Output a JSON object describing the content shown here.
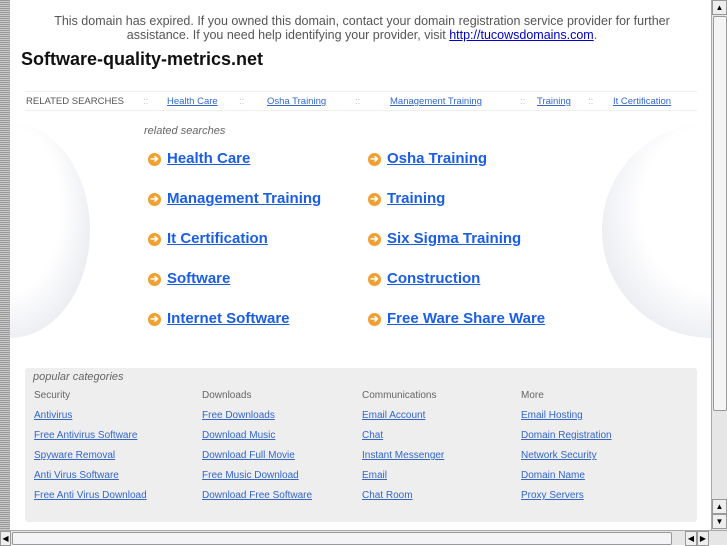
{
  "notice": {
    "text": "This domain has expired. If you owned this domain, contact your domain registration service provider for further assistance. If you need help identifying your provider, visit ",
    "link": "http://tucowsdomains.com",
    "end": "."
  },
  "site_title": "Software-quality-metrics.net",
  "related_bar": {
    "label": "RELATED SEARCHES",
    "sep": "::",
    "links": [
      "Health Care",
      "Osha Training",
      "Management Training",
      "Training",
      "It Certification"
    ]
  },
  "related": {
    "title": "related searches",
    "items": [
      "Health Care",
      "Osha Training",
      "Management Training",
      "Training",
      "It Certification",
      "Six Sigma Training",
      "Software",
      "Construction",
      "Internet Software",
      "Free Ware Share Ware"
    ]
  },
  "popular": {
    "title": "popular categories",
    "columns": [
      {
        "heading": "Security",
        "links": [
          "Antivirus",
          "Free Antivirus Software",
          "Spyware Removal",
          "Anti Virus Software",
          "Free Anti Virus Download"
        ]
      },
      {
        "heading": "Downloads",
        "links": [
          "Free Downloads",
          "Download Music",
          "Download Full Movie",
          "Free Music Download",
          "Download Free Software"
        ]
      },
      {
        "heading": "Communications",
        "links": [
          "Email Account",
          "Chat",
          "Instant Messenger",
          "Email",
          "Chat Room"
        ]
      },
      {
        "heading": "More",
        "links": [
          "Email Hosting",
          "Domain Registration",
          "Network Security",
          "Domain Name",
          "Proxy Servers"
        ]
      }
    ]
  }
}
